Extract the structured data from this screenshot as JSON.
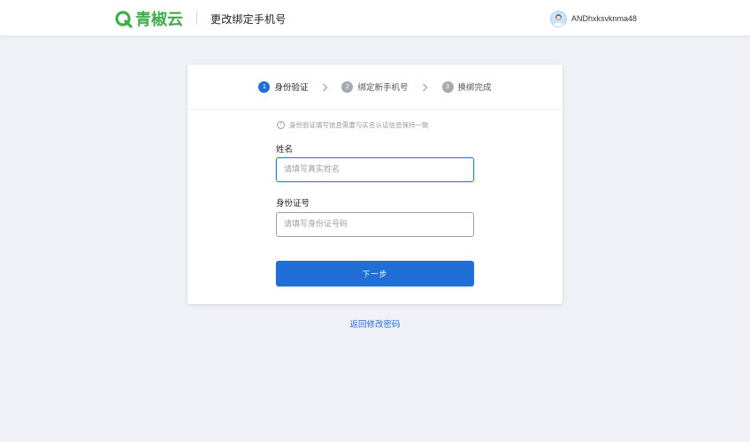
{
  "header": {
    "logo_text": "青椒云",
    "page_title": "更改绑定手机号",
    "username": "ANDhxksvknma48"
  },
  "steps": [
    {
      "number": "1",
      "label": "身份验证",
      "state": "active"
    },
    {
      "number": "2",
      "label": "绑定新手机号",
      "state": "inactive"
    },
    {
      "number": "3",
      "label": "换绑完成",
      "state": "inactive"
    }
  ],
  "form": {
    "notice": "身份验证填写信息需要与实名认证信息保持一致",
    "name_label": "姓名",
    "name_placeholder": "请填写真实姓名",
    "name_value": "",
    "id_label": "身份证号",
    "id_placeholder": "请填写身份证号码",
    "id_value": "",
    "next_label": "下一步"
  },
  "footer": {
    "back_link": "返回修改密码"
  },
  "colors": {
    "brand_green": "#3fae49",
    "primary_blue": "#1f6fd6",
    "link_blue": "#2a6fcf",
    "background": "#f0f1f6"
  },
  "icons": {
    "logo": "qingjiao-logo-icon",
    "avatar": "user-avatar-icon",
    "step_separator": "chevron-right-icon",
    "notice": "info-circle-icon"
  }
}
